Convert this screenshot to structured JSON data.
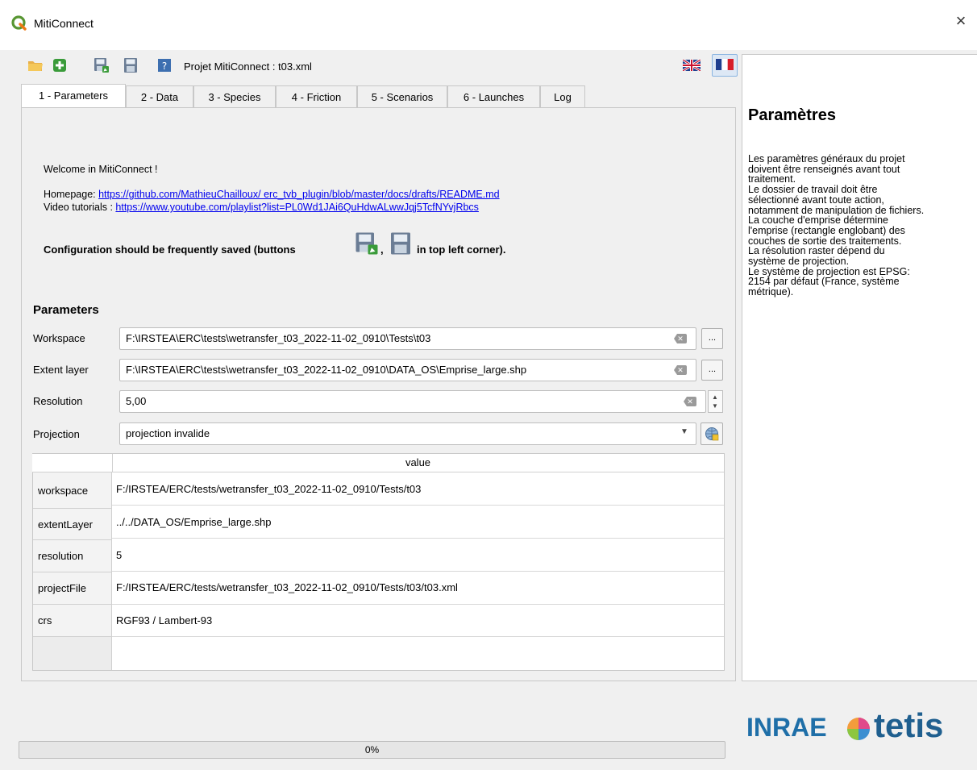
{
  "window": {
    "title": "MitiConnect",
    "close_label": "×"
  },
  "toolbar": {
    "project_label": "Projet MitiConnect : t03.xml",
    "icons": [
      "folder-open-icon",
      "add-icon",
      "save-as-icon",
      "save-icon",
      "help-icon"
    ],
    "languages": [
      "en",
      "fr"
    ],
    "active_language": "fr"
  },
  "tabs": [
    {
      "label": "1 - Parameters"
    },
    {
      "label": "2 - Data"
    },
    {
      "label": "3 - Species"
    },
    {
      "label": "4 - Friction"
    },
    {
      "label": "5 - Scenarios"
    },
    {
      "label": "6 - Launches"
    },
    {
      "label": "Log"
    }
  ],
  "intro": {
    "welcome": "Welcome in MitiConnect !",
    "homepage_label": "Homepage: ",
    "homepage_url": "https://github.com/MathieuChailloux/ erc_tvb_plugin/blob/master/docs/drafts/README.md",
    "video_label": "Video tutorials : ",
    "video_url": "https://www.youtube.com/playlist?list=PL0Wd1JAi6QuHdwALwwJqj5TcfNYvjRbcs",
    "config_prefix": "Configuration should be frequently saved (buttons",
    "config_comma": ",",
    "config_suffix": "in top left corner)."
  },
  "parameters": {
    "heading": "Parameters",
    "workspace_label": "Workspace",
    "workspace_value": "F:\\IRSTEA\\ERC\\tests\\wetransfer_t03_2022-11-02_0910\\Tests\\t03",
    "extent_label": "Extent layer",
    "extent_value": "F:\\IRSTEA\\ERC\\tests\\wetransfer_t03_2022-11-02_0910\\DATA_OS\\Emprise_large.shp",
    "resolution_label": "Resolution",
    "resolution_value": "5,00",
    "projection_label": "Projection",
    "projection_value": "projection invalide",
    "browse_label": "..."
  },
  "table": {
    "header": "value",
    "rows": [
      {
        "key": "workspace",
        "value": "F:/IRSTEA/ERC/tests/wetransfer_t03_2022-11-02_0910/Tests/t03"
      },
      {
        "key": "extentLayer",
        "value": "../../DATA_OS/Emprise_large.shp"
      },
      {
        "key": "resolution",
        "value": "5"
      },
      {
        "key": "projectFile",
        "value": "F:/IRSTEA/ERC/tests/wetransfer_t03_2022-11-02_0910/Tests/t03/t03.xml"
      },
      {
        "key": "crs",
        "value": "RGF93 / Lambert-93"
      }
    ]
  },
  "help": {
    "title": "Paramètres",
    "lines": [
      " Les paramètres généraux du projet",
      "doivent être renseignés avant tout",
      "traitement.",
      " Le dossier de travail doit être",
      "sélectionné avant toute action,",
      "notamment de manipulation de fichiers.",
      " La couche d'emprise détermine",
      "l'emprise (rectangle englobant) des",
      "couches de sortie des traitements.",
      " La résolution raster dépend du",
      "système de projection.",
      "Le système de projection est EPSG:",
      "2154 par défaut (France, système",
      "métrique)."
    ]
  },
  "logos": {
    "inrae": "INRAE",
    "tetis": "tetis"
  },
  "progress": {
    "value": 0,
    "label": "0%"
  }
}
